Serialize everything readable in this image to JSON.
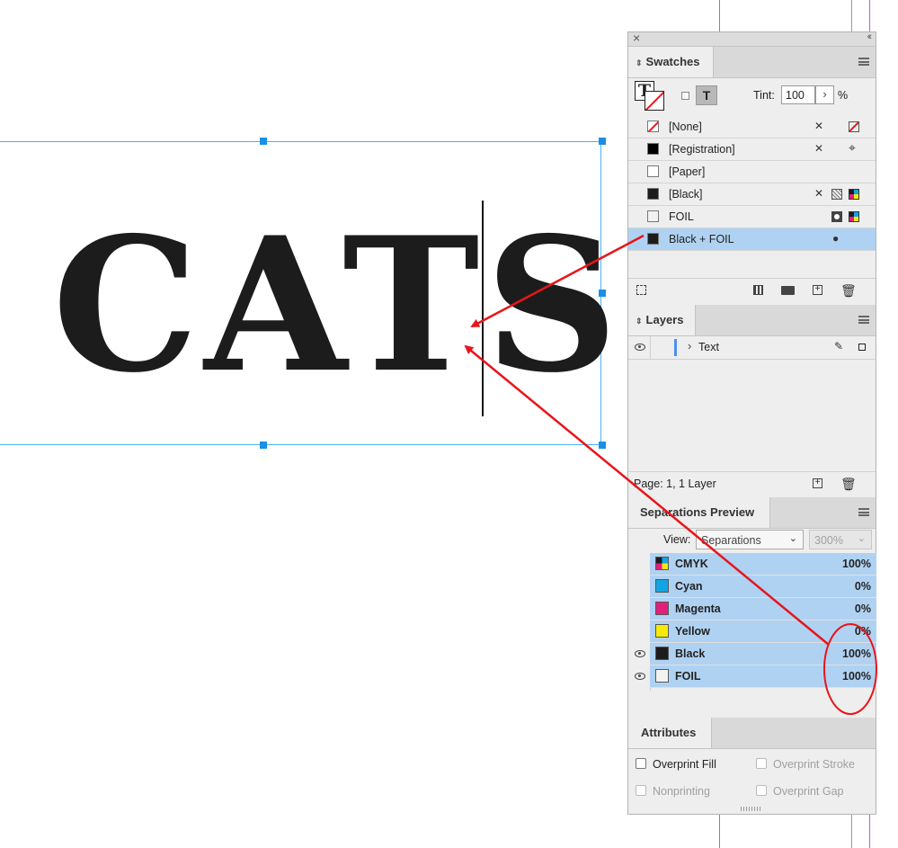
{
  "canvas": {
    "text": "CATS"
  },
  "panel": {
    "close_glyph": "×",
    "collapse_glyph": "‹‹",
    "swatches": {
      "title": "Swatches",
      "tint_label": "Tint:",
      "tint_value": "100",
      "tint_unit": "%",
      "items": [
        {
          "label": "[None]",
          "color": "none"
        },
        {
          "label": "[Registration]",
          "color": "#000000"
        },
        {
          "label": "[Paper]",
          "color": "#ffffff"
        },
        {
          "label": "[Black]",
          "color": "#1c1c1c"
        },
        {
          "label": "FOIL",
          "color": "#f2f2f2"
        },
        {
          "label": "Black + FOIL",
          "color": "#1c1c1c",
          "selected": true
        }
      ]
    },
    "layers": {
      "title": "Layers",
      "layer_name": "Text",
      "status": "Page: 1, 1 Layer"
    },
    "separations": {
      "title": "Separations Preview",
      "view_label": "View:",
      "view_value": "Separations",
      "zoom_value": "300%",
      "rows": [
        {
          "name": "CMYK",
          "pct": "100%",
          "color": "cmyk",
          "eye": false
        },
        {
          "name": "Cyan",
          "pct": "0%",
          "color": "#13a4e3",
          "eye": false
        },
        {
          "name": "Magenta",
          "pct": "0%",
          "color": "#e1207d",
          "eye": false
        },
        {
          "name": "Yellow",
          "pct": "0%",
          "color": "#f7ea0a",
          "eye": false
        },
        {
          "name": "Black",
          "pct": "100%",
          "color": "#1c1c1c",
          "eye": true
        },
        {
          "name": "FOIL",
          "pct": "100%",
          "color": "#f2f2f2",
          "eye": true
        }
      ]
    },
    "attributes": {
      "title": "Attributes",
      "overprint_fill": "Overprint Fill",
      "overprint_stroke": "Overprint Stroke",
      "nonprinting": "Nonprinting",
      "overprint_gap": "Overprint Gap"
    }
  },
  "annotation_color": "#e8151b"
}
